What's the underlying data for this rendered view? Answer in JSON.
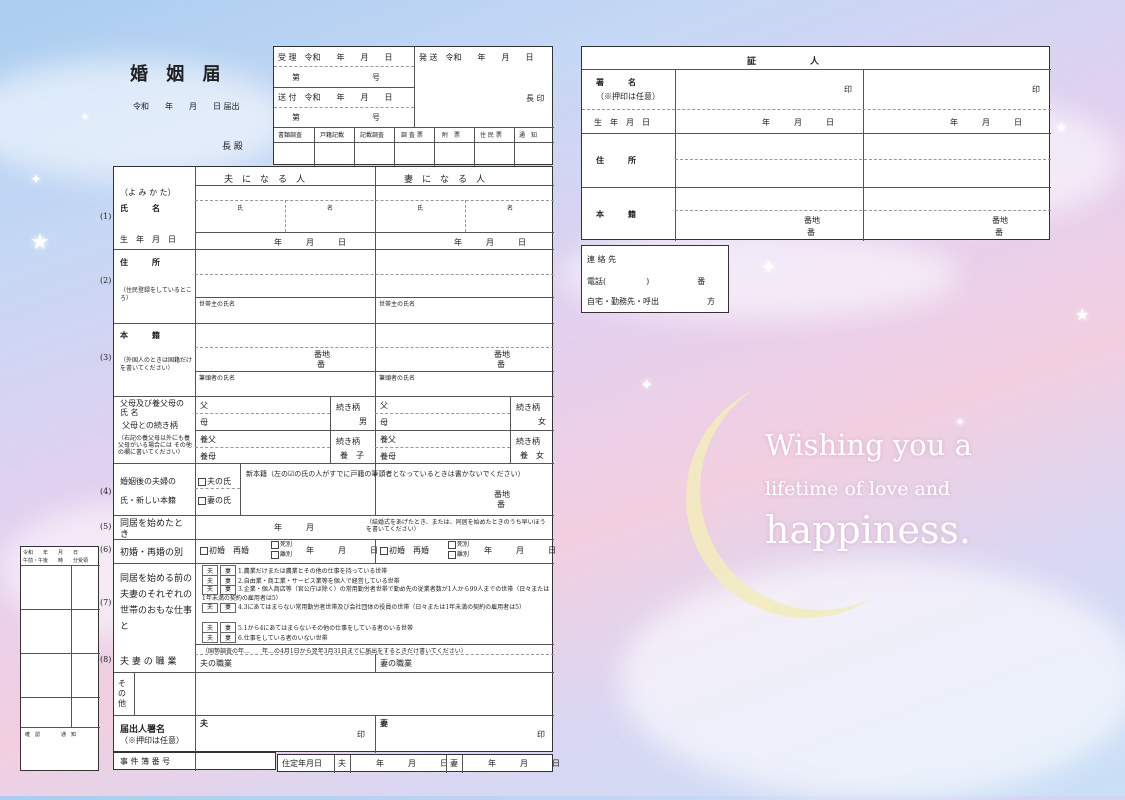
{
  "title": "婚 姻 届",
  "header": {
    "date": "令和　　年　　月　　日 届出",
    "addressee": "長 殿"
  },
  "receipt": {
    "r1": "受 理　令和　　年　　月　　日",
    "r1b": "第　　　　　　　　　号",
    "send": "発 送　令和　　年　　月　　日",
    "r2": "送 付　令和　　年　　月　　日",
    "r2b": "第　　　　　　　　　号",
    "chief": "長 印",
    "cells": [
      "書類調査",
      "戸籍記載",
      "記載調査",
      "調 査 票",
      "附　票",
      "住 民 票",
      "通　知"
    ]
  },
  "form": {
    "col_husband": "夫　に　な　る　人",
    "col_wife": "妻　に　な　る　人",
    "yomikata": "（よ み か た）",
    "name_label": "氏　　　名",
    "surname": "氏",
    "given": "名",
    "birth_label": "生　年　月　日",
    "ymd": "年　　　月　　　日",
    "address_label": "住　　　所",
    "address_note": "（住民登録をしているところ）",
    "householder": "世帯主の氏名",
    "honseki_label": "本　　　籍",
    "honseki_note": "（外国人のときは国籍だけを書いてください）",
    "banchi": "番地",
    "ban": "番",
    "hittousha": "筆頭者の氏名",
    "parents_label": "父母及び養父母の 氏 名",
    "parents_rel": "父母との続き柄",
    "adopt_note": "（右記の養父母以外にも養父母がいる場合には その他の欄に書いてください）",
    "father": "父",
    "mother": "母",
    "yofu": "養父",
    "yobo": "養母",
    "zokugara": "続き柄",
    "son": "男",
    "daughter": "女",
    "yoshi": "養　子",
    "yojo": "養　女",
    "surname_label1": "婚姻後の夫婦の",
    "surname_label2": "氏・新しい本籍",
    "husband_surname": "夫の氏",
    "wife_surname": "妻の氏",
    "new_honseki": "新本籍（左の☑の氏の人がすでに戸籍の筆頭者となっているときは書かないでください）",
    "cohab_label": "同居を始めたとき",
    "cohab_ym": "年　　　月",
    "cohab_note": "（結婚式をあげたとき、または、同居を始めたときのうち早いほうを書いてください）",
    "first_label": "初婚・再婚の別",
    "first": "初婚",
    "re": "再婚",
    "shibetsu": "死別",
    "rikon": "離別",
    "work_label": "同居を始める前の夫妻のそれぞれの世帯のおもな仕事と",
    "husband_tag": "夫",
    "wife_tag": "妻",
    "work_items": [
      "1.農業だけまたは農業とその他の仕事を持っている世帯",
      "2.自由業・商工業・サービス業等を個人で経営している世帯",
      "3.企業・個人商店等（官公庁は除く）の常用勤労者世帯で勤め先の従業者数が1人から99人までの世帯（日々または1年未満の契約の雇用者は5）",
      "4.3にあてはまらない常用勤労者世帯及び会社団体の役員の世帯（日々または1年未満の契約の雇用者は5）",
      "5.1から4にあてはまらないその他の仕事をしている者のいる世帯",
      "6.仕事をしている者のいない世帯"
    ],
    "census_note": "（国勢調査の年…　　年…の4月1日から翌年3月31日までに届出をするときだけ書いてください）",
    "job_label": "夫 妻 の 職 業",
    "husband_job": "夫の職業",
    "wife_job": "妻の職業",
    "other_label": "その他",
    "sign_label": "届出人署名",
    "sign_note": "（※押印は任意）",
    "husband": "夫",
    "wife": "妻",
    "seal": "印",
    "case_label": "事 件 簿 番 号",
    "jutei": "住定年月日",
    "nums": [
      "(1)",
      "(2)",
      "(3)",
      "(4)",
      "(5)",
      "(6)",
      "(7)",
      "(8)"
    ]
  },
  "witness": {
    "title": "証　　　　　　人",
    "sign": "署　　　名",
    "sign_note": "（※押印は任意）",
    "seal": "印",
    "birth": "生　年　月　日",
    "ymd": "年　　　月　　　日",
    "address": "住　　　所",
    "honseki": "本　　　籍",
    "banchi": "番地",
    "ban": "番"
  },
  "contact": {
    "label": "連 絡 先",
    "tel": "電話(　　　　　)　　　　　　番",
    "place": "自宅・勤務先・呼出　　　　　　方"
  },
  "small": {
    "l1": "令和　　年　　月　　日",
    "l2": "午前・午後　　時　　分受領",
    "b1": "確　認",
    "b2": "通　知"
  },
  "message": {
    "l1": "Wishing you a",
    "l2": "lifetime of love and",
    "l3": "happiness."
  },
  "colors": {
    "sky": "#a9cdf0",
    "pink": "#f2cfe0",
    "moon": "#f3ecc0"
  }
}
